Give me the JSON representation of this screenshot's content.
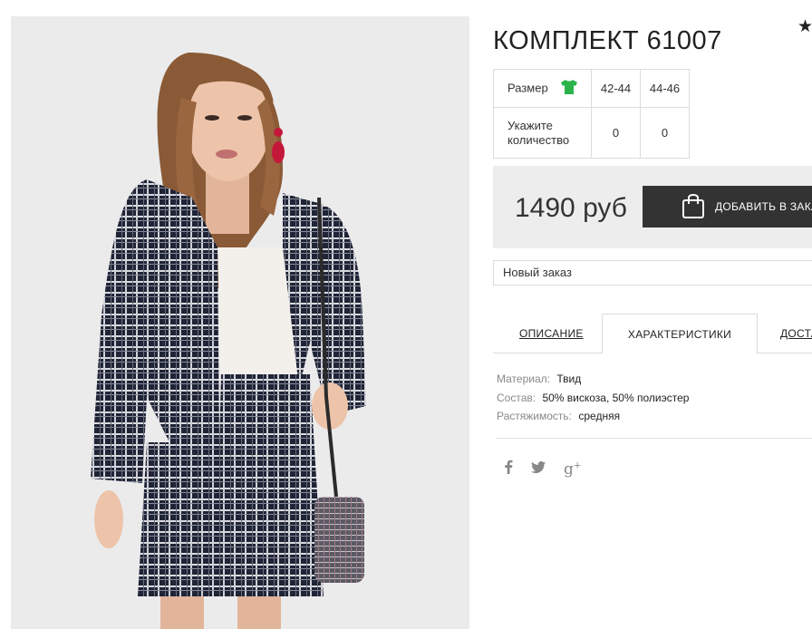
{
  "product": {
    "title": "КОМПЛЕКТ 61007",
    "favorite_icon": "star-icon"
  },
  "sizes": {
    "size_label": "Размер",
    "size_icon": "tshirt-icon",
    "columns": [
      "42-44",
      "44-46"
    ],
    "quantity_label_line1": "Укажите",
    "quantity_label_line2": "количество",
    "quantities": [
      "0",
      "0"
    ]
  },
  "buy": {
    "price": "1490 руб",
    "add_button_label": "ДОБАВИТЬ В ЗАКАЗ",
    "bag_icon": "shopping-bag-icon"
  },
  "order": {
    "selected": "Новый заказ"
  },
  "tabs": [
    {
      "label": "ОПИСАНИЕ",
      "active": false
    },
    {
      "label": "ХАРАКТЕРИСТИКИ",
      "active": true
    },
    {
      "label": "ДОСТАВКА",
      "active": false
    }
  ],
  "specs": [
    {
      "key": "Материал:",
      "value": "Твид"
    },
    {
      "key": "Состав:",
      "value": "50% вискоза, 50% полиэстер"
    },
    {
      "key": "Растяжимость:",
      "value": "средняя"
    }
  ],
  "social": [
    "facebook-icon",
    "twitter-icon",
    "google-plus-icon"
  ],
  "colors": {
    "accent_dark": "#333333",
    "panel_bg": "#ededed",
    "size_icon_green": "#2bb34a"
  }
}
